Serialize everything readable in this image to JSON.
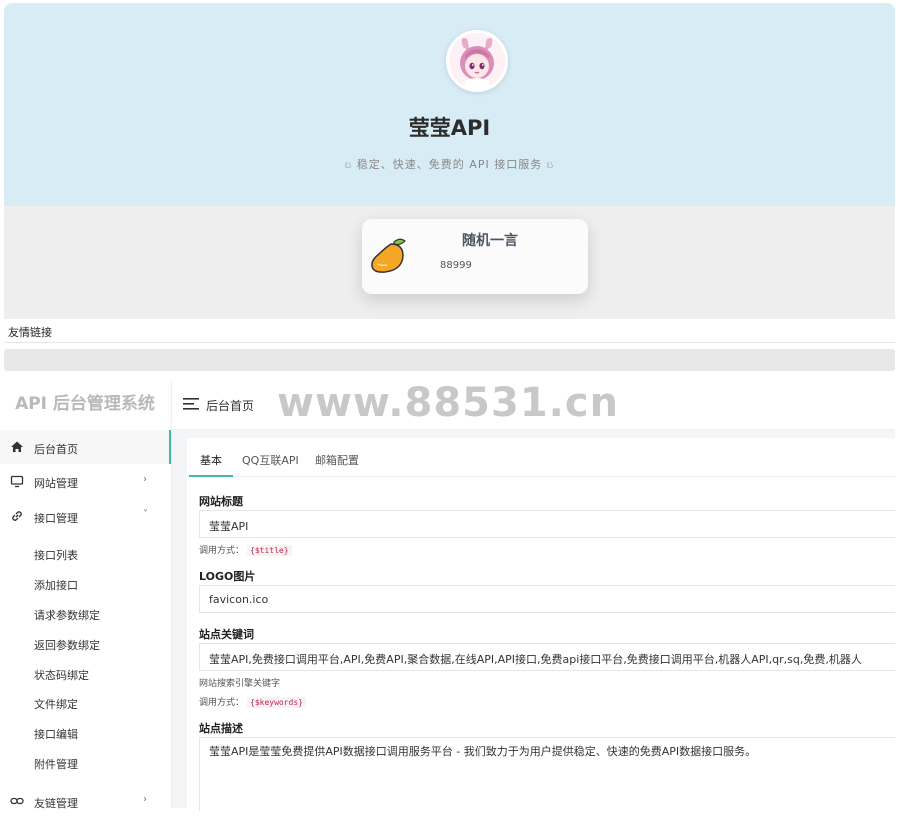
{
  "hero": {
    "title": "莹莹API",
    "subtitle": "稳定、快速、免费的 API 接口服务",
    "swirl_left": "ઇ",
    "swirl_right": "ઇ"
  },
  "quote_card": {
    "title": "随机一言",
    "text": "88999",
    "icon": "mango-icon"
  },
  "friends": {
    "label": "友情链接"
  },
  "admin": {
    "brand": "API 后台管理系统",
    "breadcrumb": "后台首页",
    "watermark": "www.88531.cn",
    "sidebar": {
      "items": [
        {
          "label": "后台首页",
          "icon": "home-icon",
          "active": true
        },
        {
          "label": "网站管理",
          "icon": "monitor-icon",
          "chevron": "›"
        },
        {
          "label": "接口管理",
          "icon": "link-icon",
          "chevron": "˅"
        },
        {
          "label": "友链管理",
          "icon": "link-icon",
          "chevron": "›"
        }
      ],
      "sub_items": [
        "接口列表",
        "添加接口",
        "请求参数绑定",
        "返回参数绑定",
        "状态码绑定",
        "文件绑定",
        "接口编辑",
        "附件管理"
      ]
    },
    "tabs": [
      "基本",
      "QQ互联API",
      "邮箱配置"
    ],
    "form": {
      "site_title_label": "网站标题",
      "site_title_value": "莹莹API",
      "site_title_help": "调用方式：",
      "site_title_code": "{$title}",
      "logo_label": "LOGO图片",
      "logo_value": "favicon.ico",
      "keywords_label": "站点关键词",
      "keywords_value": "莹莹API,免费接口调用平台,API,免费API,聚合数据,在线API,API接口,免费api接口平台,免费接口调用平台,机器人API,qr,sq,免费,机器人",
      "keywords_help": "网站搜索引擎关键字",
      "keywords_help2": "调用方式：",
      "keywords_code": "{$keywords}",
      "description_label": "站点描述",
      "description_value": "莹莹API是莹莹免费提供API数据接口调用服务平台 - 我们致力于为用户提供稳定、快速的免费API数据接口服务。"
    }
  },
  "colors": {
    "hero_bg": "#d8ecf6",
    "accent": "#41b8a8",
    "code_red": "#c7254e"
  }
}
